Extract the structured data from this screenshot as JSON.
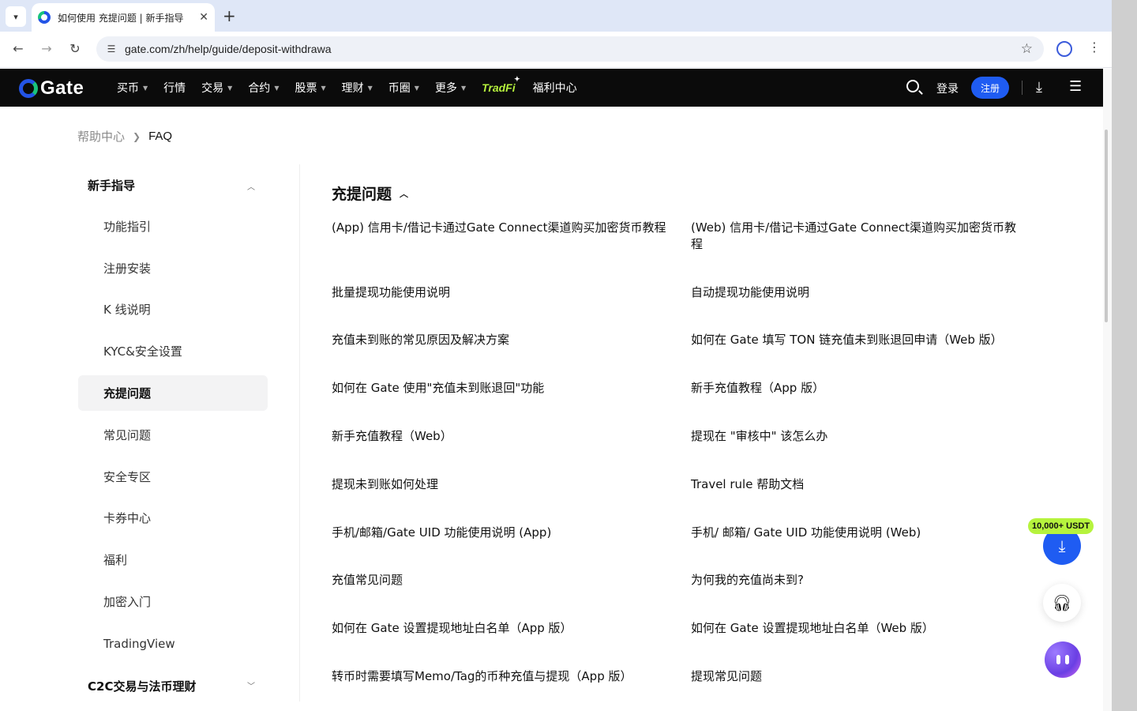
{
  "browser": {
    "tab_title": "如何使用 充提问题 | 新手指导",
    "tab_close": "✕",
    "new_tab": "+",
    "url": "gate.com/zh/help/guide/deposit-withdrawa",
    "icons": [
      "tab-list-icon",
      "back-icon",
      "forward-icon",
      "reload-icon",
      "site-info-icon",
      "bookmark-star-icon",
      "profile-icon",
      "menu-kebab-icon"
    ]
  },
  "header": {
    "logo_text": "Gate",
    "menu": [
      {
        "label": "买币",
        "has_caret": true
      },
      {
        "label": "行情",
        "has_caret": false
      },
      {
        "label": "交易",
        "has_caret": true
      },
      {
        "label": "合约",
        "has_caret": true
      },
      {
        "label": "股票",
        "has_caret": true
      },
      {
        "label": "理财",
        "has_caret": true
      },
      {
        "label": "币圈",
        "has_caret": true
      },
      {
        "label": "更多",
        "has_caret": true
      }
    ],
    "tradfi": "TradFi",
    "welfare": "福利中心",
    "login": "登录",
    "register": "注册",
    "accent": "#1f5cf2",
    "tradfi_color": "#b6f33d"
  },
  "breadcrumb": {
    "home": "帮助中心",
    "current": "FAQ"
  },
  "sidebar": {
    "group_open": "新手指导",
    "items": [
      {
        "label": "功能指引"
      },
      {
        "label": "注册安装"
      },
      {
        "label": "K 线说明"
      },
      {
        "label": "KYC&安全设置"
      },
      {
        "label": "充提问题",
        "active": true
      },
      {
        "label": "常见问题"
      },
      {
        "label": "安全专区"
      },
      {
        "label": "卡券中心"
      },
      {
        "label": "福利"
      },
      {
        "label": "加密入门"
      },
      {
        "label": "TradingView"
      }
    ],
    "group_collapsed": "C2C交易与法币理财"
  },
  "content": {
    "section_title": "充提问题",
    "links": [
      "(App) 信用卡/借记卡通过Gate Connect渠道购买加密货币教程",
      "(Web) 信用卡/借记卡通过Gate Connect渠道购买加密货币教程",
      "批量提现功能使用说明",
      "自动提现功能使用说明",
      "充值未到账的常见原因及解决方案",
      "如何在 Gate 填写 TON 链充值未到账退回申请（Web 版）",
      "如何在 Gate 使用\"充值未到账退回\"功能",
      "新手充值教程（App 版）",
      "新手充值教程（Web）",
      "提现在 \"审核中\" 该怎么办",
      "提现未到账如何处理",
      "Travel rule 帮助文档",
      "手机/邮箱/Gate UID 功能使用说明 (App)",
      "手机/ 邮箱/ Gate UID 功能使用说明 (Web)",
      "充值常见问题",
      "为何我的充值尚未到?",
      "如何在 Gate 设置提现地址白名单（App 版）",
      "如何在 Gate 设置提现地址白名单（Web 版）",
      "转币时需要填写Memo/Tag的币种充值与提现（App 版）",
      "提现常见问题"
    ]
  },
  "floating": {
    "badge": "10,000+ USDT"
  }
}
